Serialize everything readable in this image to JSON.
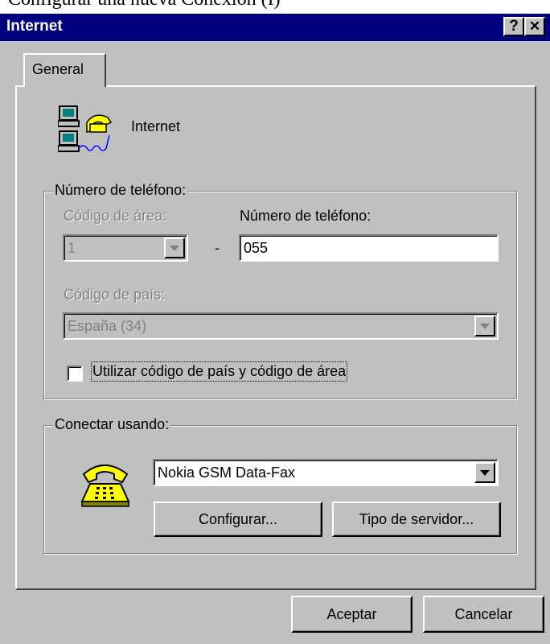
{
  "background_caption": "Configurar una nueva Conexión (I)",
  "window": {
    "title": "Internet",
    "help_button": "?",
    "close_button": "✕"
  },
  "tabs": [
    {
      "label": "General"
    }
  ],
  "connection": {
    "icon": "dialup-network-icon",
    "name": "Internet"
  },
  "phone_group": {
    "legend": "Número de teléfono:",
    "area_code_label": "Código de área:",
    "area_code_value": "1",
    "separator": "-",
    "phone_label": "Número de teléfono:",
    "phone_value": "055",
    "country_label": "Código de país:",
    "country_value": "España (34)",
    "use_codes_label": "Utilizar código de país y código de área",
    "use_codes_checked": false
  },
  "connect_group": {
    "legend": "Conectar usando:",
    "icon": "telephone-icon",
    "modem_value": "Nokia GSM Data-Fax",
    "configure_button": "Configurar...",
    "server_type_button": "Tipo de servidor..."
  },
  "footer": {
    "ok_button": "Aceptar",
    "cancel_button": "Cancelar"
  }
}
